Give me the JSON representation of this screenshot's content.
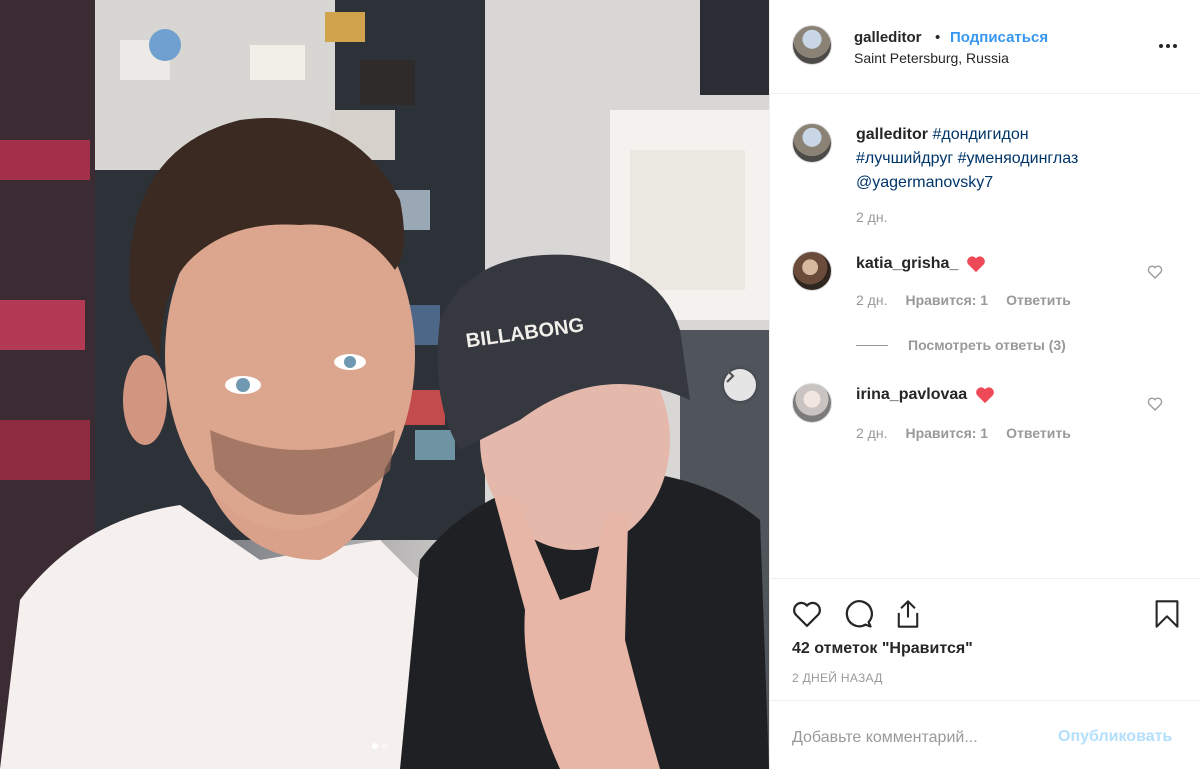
{
  "header": {
    "username": "galleditor",
    "separator": "•",
    "follow_label": "Подписаться",
    "location": "Saint Petersburg, Russia"
  },
  "caption": {
    "username": "galleditor",
    "hashtag1": "#дондигидон",
    "hashtag2": "#лучшийдруг",
    "hashtag3": "#уменяодинглаз",
    "mention": "@yagermanovsky7",
    "time": "2 дн."
  },
  "comments": [
    {
      "username": "katia_grisha_",
      "emoji": "heart",
      "time": "2 дн.",
      "likes": "Нравится: 1",
      "reply_label": "Ответить"
    },
    {
      "username": "irina_pavlovaa",
      "emoji": "heart",
      "time": "2 дн.",
      "likes": "Нравится: 1",
      "reply_label": "Ответить"
    }
  ],
  "view_replies": "Посмотреть ответы (3)",
  "post_footer": {
    "likes_text": "42 отметок \"Нравится\"",
    "time_ago": "2 ДНЕЙ НАЗАД"
  },
  "add_comment": {
    "placeholder": "Добавьте комментарий...",
    "publish_label": "Опубликовать"
  },
  "carousel": {
    "slide": 1,
    "total": 2
  },
  "colors": {
    "link_blue": "#3897f0",
    "hashtag_blue": "#003569",
    "heart_red": "#ed4956",
    "muted": "#999999",
    "publish_disabled": "#b2dffc"
  },
  "photo": {
    "cap_text": "BILLABONG"
  }
}
